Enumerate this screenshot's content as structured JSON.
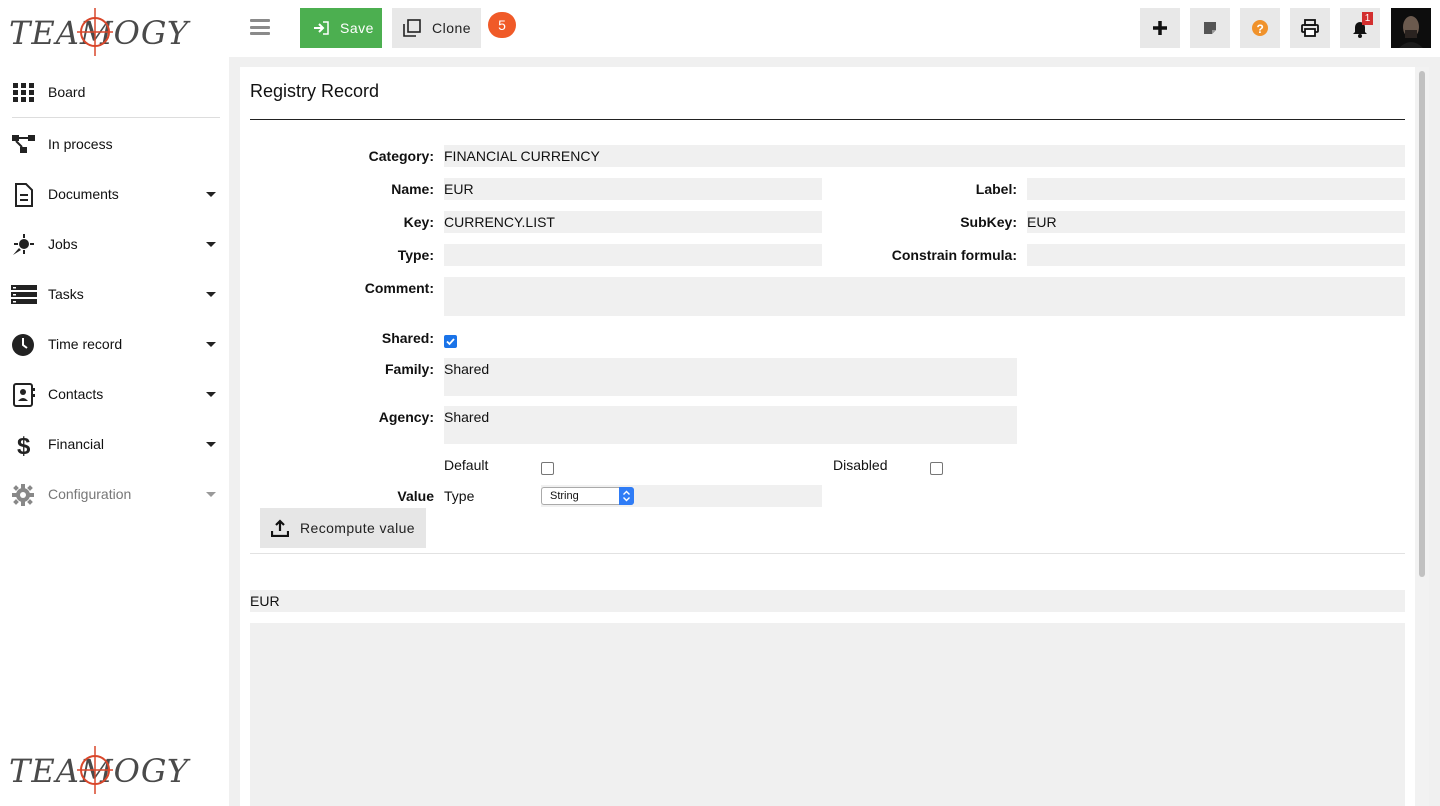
{
  "brand": {
    "logo_text": "TEAMOGY"
  },
  "sidebar": {
    "items": [
      {
        "label": "Board",
        "icon": "grid-icon",
        "caret": false
      },
      {
        "label": "In process",
        "icon": "process-icon",
        "caret": false
      },
      {
        "label": "Documents",
        "icon": "document-icon",
        "caret": true
      },
      {
        "label": "Jobs",
        "icon": "rocket-icon",
        "caret": true
      },
      {
        "label": "Tasks",
        "icon": "tasks-icon",
        "caret": true
      },
      {
        "label": "Time record",
        "icon": "clock-icon",
        "caret": true
      },
      {
        "label": "Contacts",
        "icon": "contacts-icon",
        "caret": true
      },
      {
        "label": "Financial",
        "icon": "dollar-icon",
        "caret": true
      },
      {
        "label": "Configuration",
        "icon": "gear-icon",
        "caret": true
      }
    ]
  },
  "toolbar": {
    "save_label": "Save",
    "clone_label": "Clone",
    "count_badge": "5",
    "notification_count": "1"
  },
  "colors": {
    "save_green": "#4caf50",
    "badge_orange": "#f05a28",
    "help_orange": "#f0922b",
    "notif_red": "#d32f2f"
  },
  "page": {
    "title": "Registry Record"
  },
  "form": {
    "category_label": "Category:",
    "category_value": "FINANCIAL CURRENCY",
    "name_label": "Name:",
    "name_value": "EUR",
    "label_label": "Label:",
    "label_value": "",
    "key_label": "Key:",
    "key_value": "CURRENCY.LIST",
    "subkey_label": "SubKey:",
    "subkey_value": "EUR",
    "type_label": "Type:",
    "type_value": "",
    "constrain_label": "Constrain formula:",
    "constrain_value": "",
    "comment_label": "Comment:",
    "comment_value": "",
    "shared_label": "Shared:",
    "shared_checked": true,
    "family_label": "Family:",
    "family_value": "Shared",
    "agency_label": "Agency:",
    "agency_value": "Shared",
    "default_label": "Default",
    "default_checked": false,
    "disabled_label": "Disabled",
    "disabled_checked": false,
    "value_label": "Value",
    "value_type_label": "Type",
    "value_type_selected": "String",
    "recompute_label": "Recompute value",
    "result_value": "EUR"
  }
}
